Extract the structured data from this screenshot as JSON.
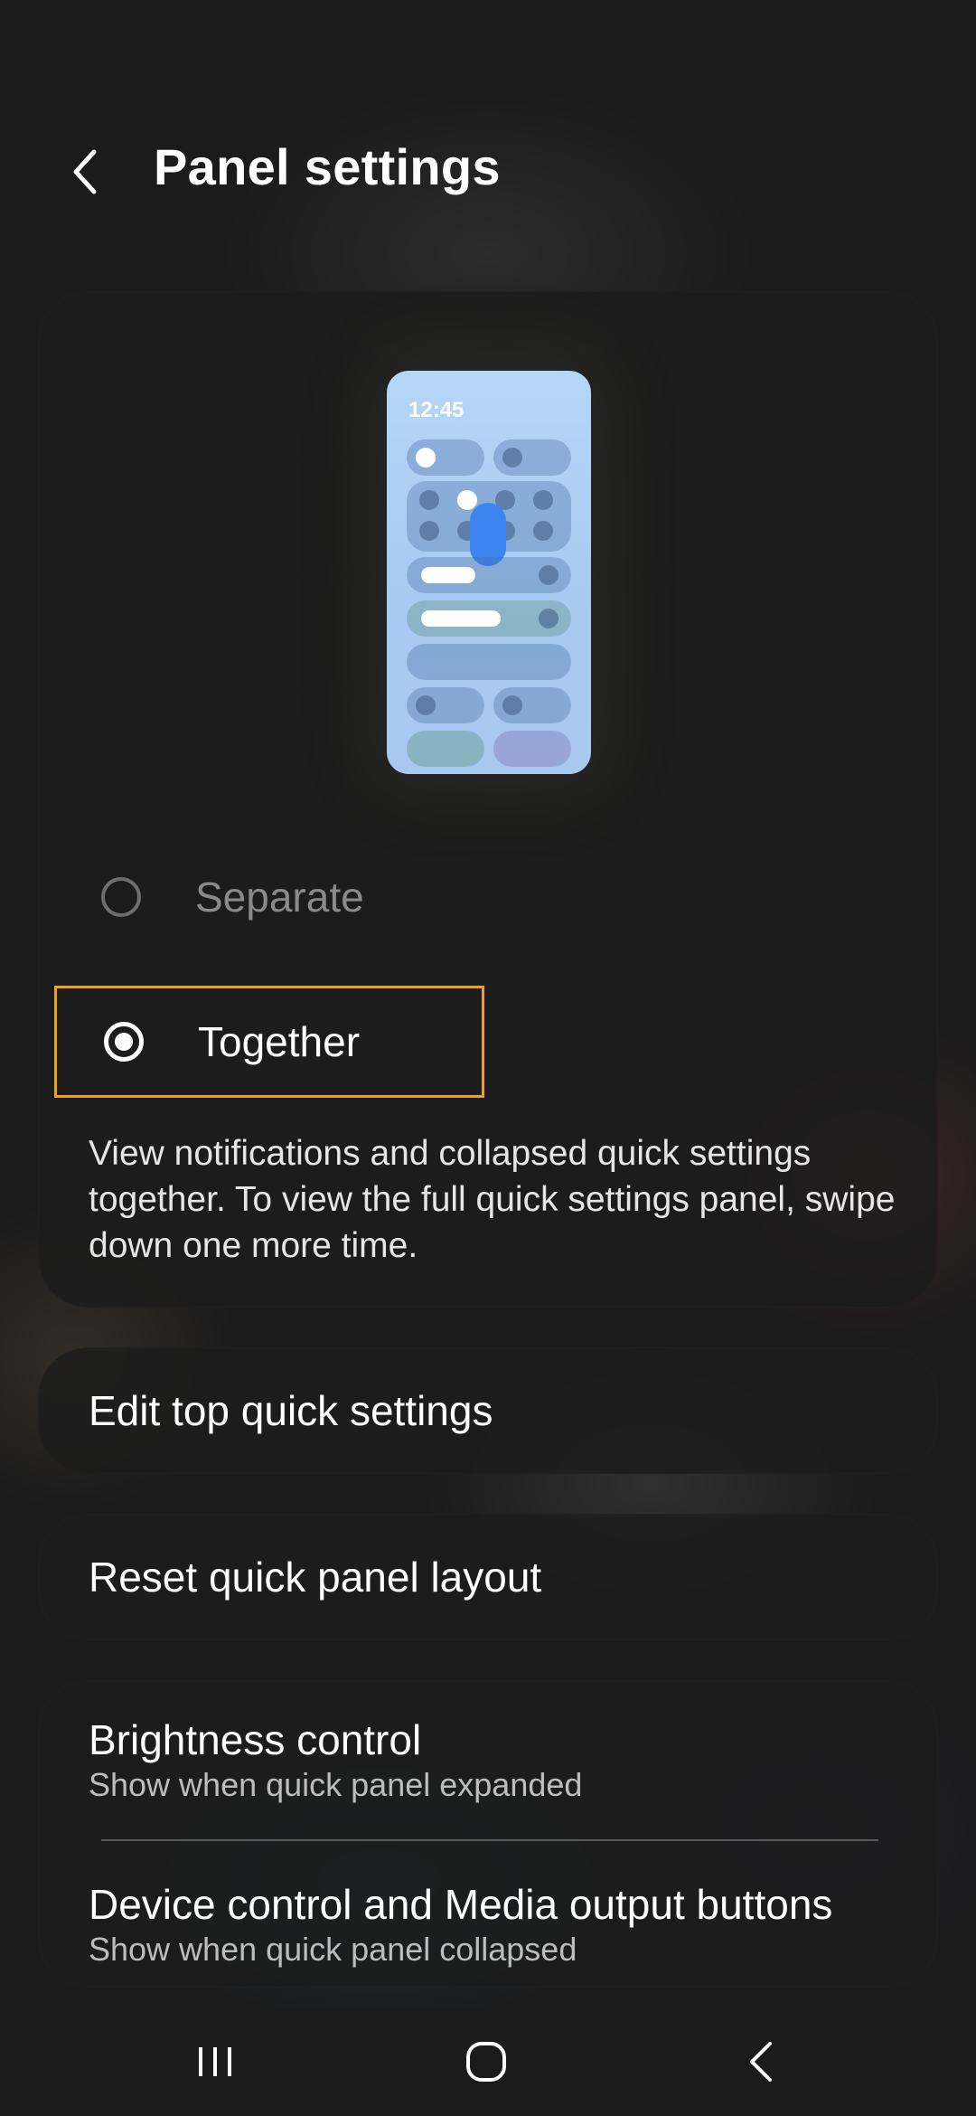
{
  "header": {
    "title": "Panel settings",
    "back_icon": "chevron-left-icon"
  },
  "preview": {
    "time": "12:45"
  },
  "layout_options": [
    {
      "label": "Separate",
      "selected": false
    },
    {
      "label": "Together",
      "selected": true
    }
  ],
  "description": "View notifications and collapsed quick settings together. To view the full quick settings panel, swipe down one more time.",
  "edit_top": {
    "label": "Edit top quick settings"
  },
  "reset_layout": {
    "label": "Reset quick panel layout"
  },
  "settings_list": [
    {
      "title": "Brightness control",
      "subtitle": "Show when quick panel expanded"
    },
    {
      "title": "Device control and Media output buttons",
      "subtitle": "Show when quick panel collapsed"
    }
  ],
  "colors": {
    "background": "#1b1b1c",
    "card": "#1c1c1d",
    "highlight_border": "#f0a020",
    "preview_accent": "#3d86f2"
  },
  "navbar": {
    "recents_icon": "recents-icon",
    "home_icon": "home-icon",
    "back_icon": "back-icon"
  }
}
